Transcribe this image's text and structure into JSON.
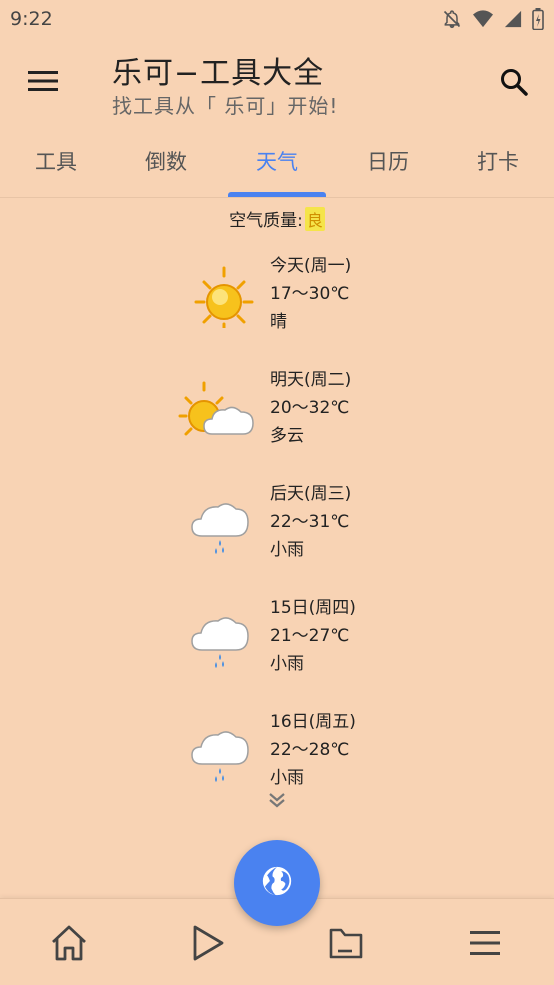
{
  "status_bar": {
    "time": "9:22",
    "icons": [
      "notifications-off-icon",
      "wifi-icon",
      "signal-icon",
      "battery-icon"
    ]
  },
  "app_bar": {
    "title": "乐可−工具大全",
    "subtitle": "找工具从「 乐可」开始!",
    "menu_icon": "hamburger-menu-icon",
    "search_icon": "search-icon"
  },
  "tabs": [
    {
      "label": "工具",
      "active": false
    },
    {
      "label": "倒数",
      "active": false
    },
    {
      "label": "天气",
      "active": true
    },
    {
      "label": "日历",
      "active": false
    },
    {
      "label": "打卡",
      "active": false
    }
  ],
  "air_quality": {
    "label": "空气质量:",
    "value": "良"
  },
  "forecast": [
    {
      "day": "今天(周一)",
      "temp": "17～30℃",
      "condition": "晴",
      "icon": "sunny-icon"
    },
    {
      "day": "明天(周二)",
      "temp": "20～32℃",
      "condition": "多云",
      "icon": "partly-cloudy-icon"
    },
    {
      "day": "后天(周三)",
      "temp": "22～31℃",
      "condition": "小雨",
      "icon": "light-rain-icon"
    },
    {
      "day": "15日(周四)",
      "temp": "21～27℃",
      "condition": "小雨",
      "icon": "light-rain-icon"
    },
    {
      "day": "16日(周五)",
      "temp": "22～28℃",
      "condition": "小雨",
      "icon": "light-rain-icon"
    }
  ],
  "more_icon": "double-chevron-down-icon",
  "fab_icon": "globe-icon",
  "bottom_nav": [
    {
      "icon": "home-icon"
    },
    {
      "icon": "play-icon"
    },
    {
      "icon": "folder-icon"
    },
    {
      "icon": "menu-icon"
    }
  ],
  "colors": {
    "background": "#f8d3b4",
    "accent": "#4a82f0",
    "air_badge_bg": "#f5e44a",
    "air_badge_text": "#d09000"
  }
}
